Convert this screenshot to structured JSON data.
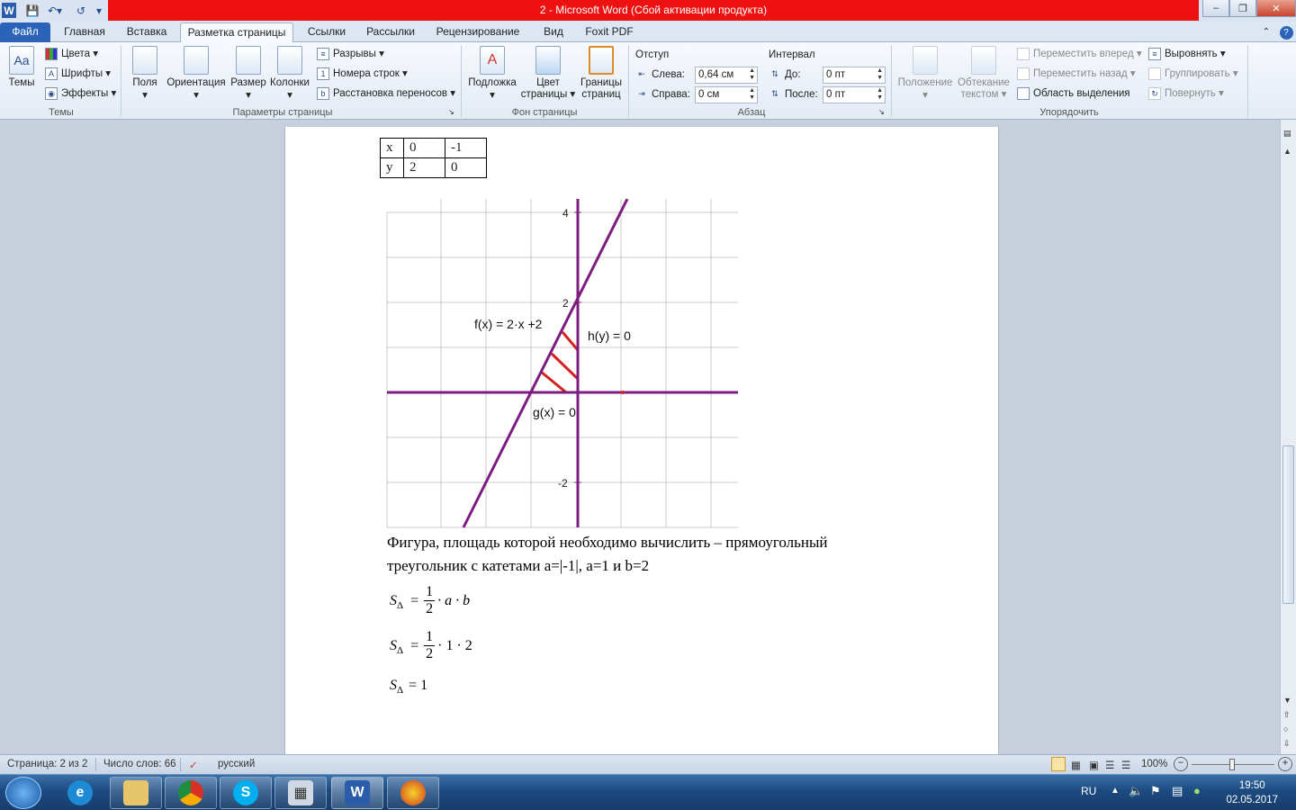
{
  "window": {
    "title": "2 -  Microsoft Word (Сбой активации продукта)",
    "controls": [
      "–",
      "❐",
      "✕"
    ]
  },
  "tabs": [
    "Файл",
    "Главная",
    "Вставка",
    "Разметка страницы",
    "Ссылки",
    "Рассылки",
    "Рецензирование",
    "Вид",
    "Foxit PDF"
  ],
  "active_tab": "Разметка страницы",
  "ribbon": {
    "themes": {
      "label": "Темы",
      "themes_btn": "Темы",
      "colors": "Цвета",
      "fonts": "Шрифты",
      "effects": "Эффекты"
    },
    "page_setup": {
      "label": "Параметры страницы",
      "margins": "Поля",
      "orientation": "Ориентация",
      "size": "Размер",
      "columns": "Колонки",
      "breaks": "Разрывы",
      "line_numbers": "Номера строк",
      "hyphenation": "Расстановка переносов"
    },
    "page_background": {
      "label": "Фон страницы",
      "watermark": "Подложка",
      "page_color": "Цвет страницы",
      "page_borders": "Границы страниц"
    },
    "paragraph": {
      "label": "Абзац",
      "indent_title": "Отступ",
      "left_label": "Слева:",
      "left_value": "0,64 см",
      "right_label": "Справа:",
      "right_value": "0 см",
      "spacing_title": "Интервал",
      "before_label": "До:",
      "before_value": "0 пт",
      "after_label": "После:",
      "after_value": "0 пт"
    },
    "arrange": {
      "label": "Упорядочить",
      "position": "Положение",
      "wrap_text": "Обтекание текстом",
      "bring_forward": "Переместить вперед",
      "send_backward": "Переместить назад",
      "selection_pane": "Область выделения",
      "align": "Выровнять",
      "group": "Группировать",
      "rotate": "Повернуть"
    }
  },
  "document": {
    "table": [
      [
        "x",
        "0",
        "-1"
      ],
      [
        "y",
        "2",
        "0"
      ]
    ],
    "graph": {
      "y_ticks": [
        "4",
        "2",
        "-2"
      ],
      "labels": {
        "f": "f(x) = 2·x +2",
        "h": "h(y) = 0",
        "g": "g(x) = 0"
      },
      "colors": {
        "lines": "#7b1c7e",
        "hatch": "#d42020",
        "grid": "#c8c8c8"
      }
    },
    "paragraph_line1": "Фигура, площадь которой необходимо вычислить – прямоугольный",
    "paragraph_line2": "треугольник с катетами a=|-1|, a=1 и b=2",
    "formulas": {
      "f1_lhs": "S",
      "f1_sub": "Δ",
      "f1_num": "1",
      "f1_den": "2",
      "f1_rest": "· a · b",
      "f2_lhs": "S",
      "f2_sub": "Δ",
      "f2_num": "1",
      "f2_den": "2",
      "f2_rest": "· 1 · 2",
      "f3_lhs": "S",
      "f3_sub": "Δ",
      "f3_rest": "= 1"
    }
  },
  "statusbar": {
    "page": "Страница: 2 из 2",
    "words": "Число слов: 66",
    "language": "русский",
    "zoom": "100%"
  },
  "taskbar": {
    "lang": "RU",
    "time": "19:50",
    "date": "02.05.2017"
  }
}
